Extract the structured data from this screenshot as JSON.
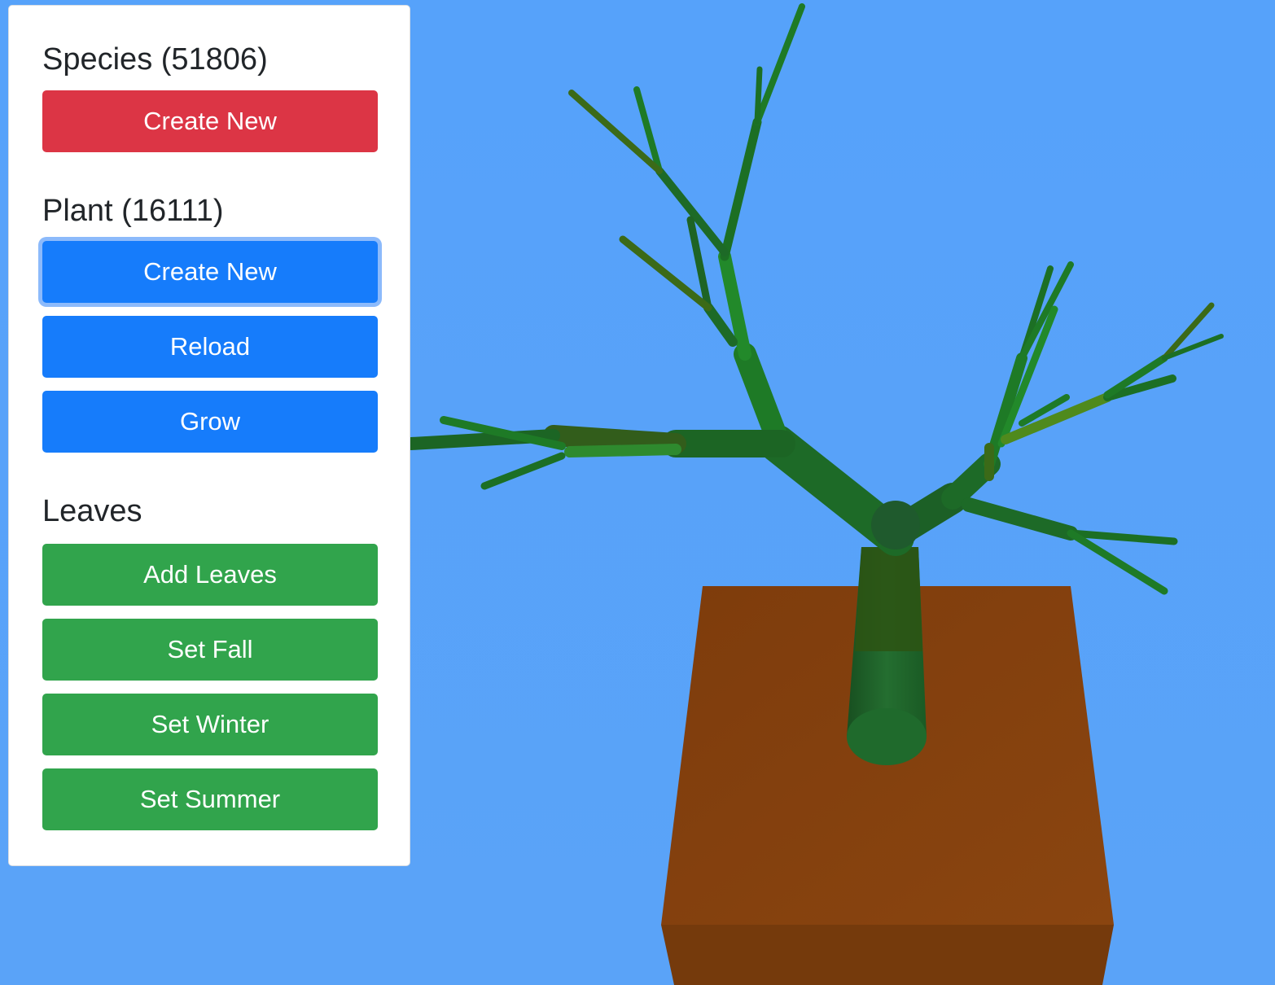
{
  "colors": {
    "sky": "#56a2fa",
    "pot": "#84400f",
    "trunk": "#1f6a2c",
    "danger": "#dc3545",
    "primary": "#167cfb",
    "success": "#31a44c"
  },
  "panel": {
    "species": {
      "title": "Species (51806)",
      "create_label": "Create New"
    },
    "plant": {
      "title": "Plant (16111)",
      "create_label": "Create New",
      "reload_label": "Reload",
      "grow_label": "Grow"
    },
    "leaves": {
      "title": "Leaves",
      "add_label": "Add Leaves",
      "fall_label": "Set Fall",
      "winter_label": "Set Winter",
      "summer_label": "Set Summer"
    }
  }
}
